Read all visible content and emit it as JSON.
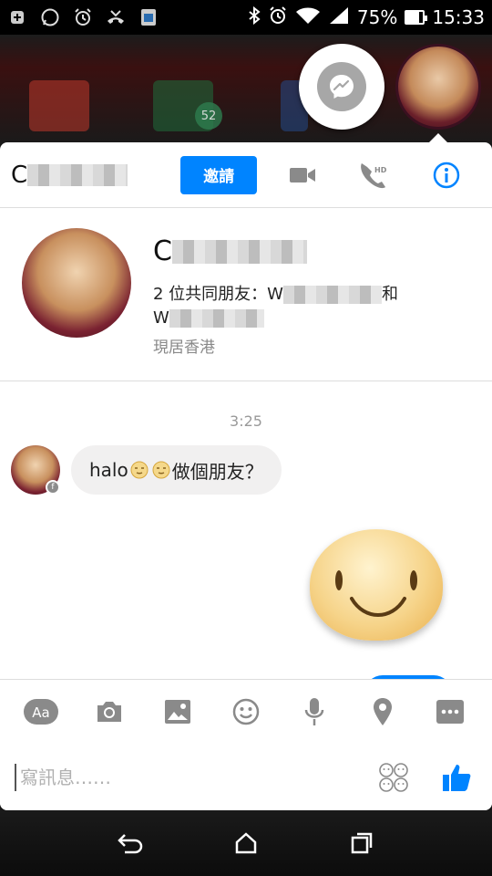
{
  "status_bar": {
    "battery": "75%",
    "battery_level": 0.75,
    "time": "15:33",
    "left_icons": [
      "notification-icon",
      "whatsapp-icon",
      "alarm-icon",
      "missed-call-icon",
      "app-icon"
    ],
    "right_icons": [
      "bluetooth-icon",
      "alarm-icon",
      "wifi-icon",
      "signal-icon",
      "battery-icon"
    ]
  },
  "background": {
    "badge_count": "52"
  },
  "header": {
    "contact_name_initial": "C",
    "invite_label": "邀請",
    "icons": [
      "video-call-icon",
      "hd-call-icon",
      "info-icon"
    ]
  },
  "profile": {
    "name_initial": "C",
    "mutual_friends_prefix": "2 位共同朋友：W",
    "mutual_friends_and": "和",
    "mutual_friends_second": "W",
    "location": "現居香港"
  },
  "conversation": {
    "timestamp": "3:25",
    "incoming_text": "halo",
    "incoming_suffix": "做個朋友？"
  },
  "composer": {
    "tools": [
      "text-format-icon",
      "camera-icon",
      "image-icon",
      "emoji-icon",
      "microphone-icon",
      "location-icon",
      "more-icon"
    ],
    "aa_label": "Aa",
    "placeholder": "寫訊息……"
  },
  "colors": {
    "messenger_blue": "#0084ff",
    "bubble_gray": "#f1f0f0",
    "icon_gray": "#8a8a8a"
  }
}
